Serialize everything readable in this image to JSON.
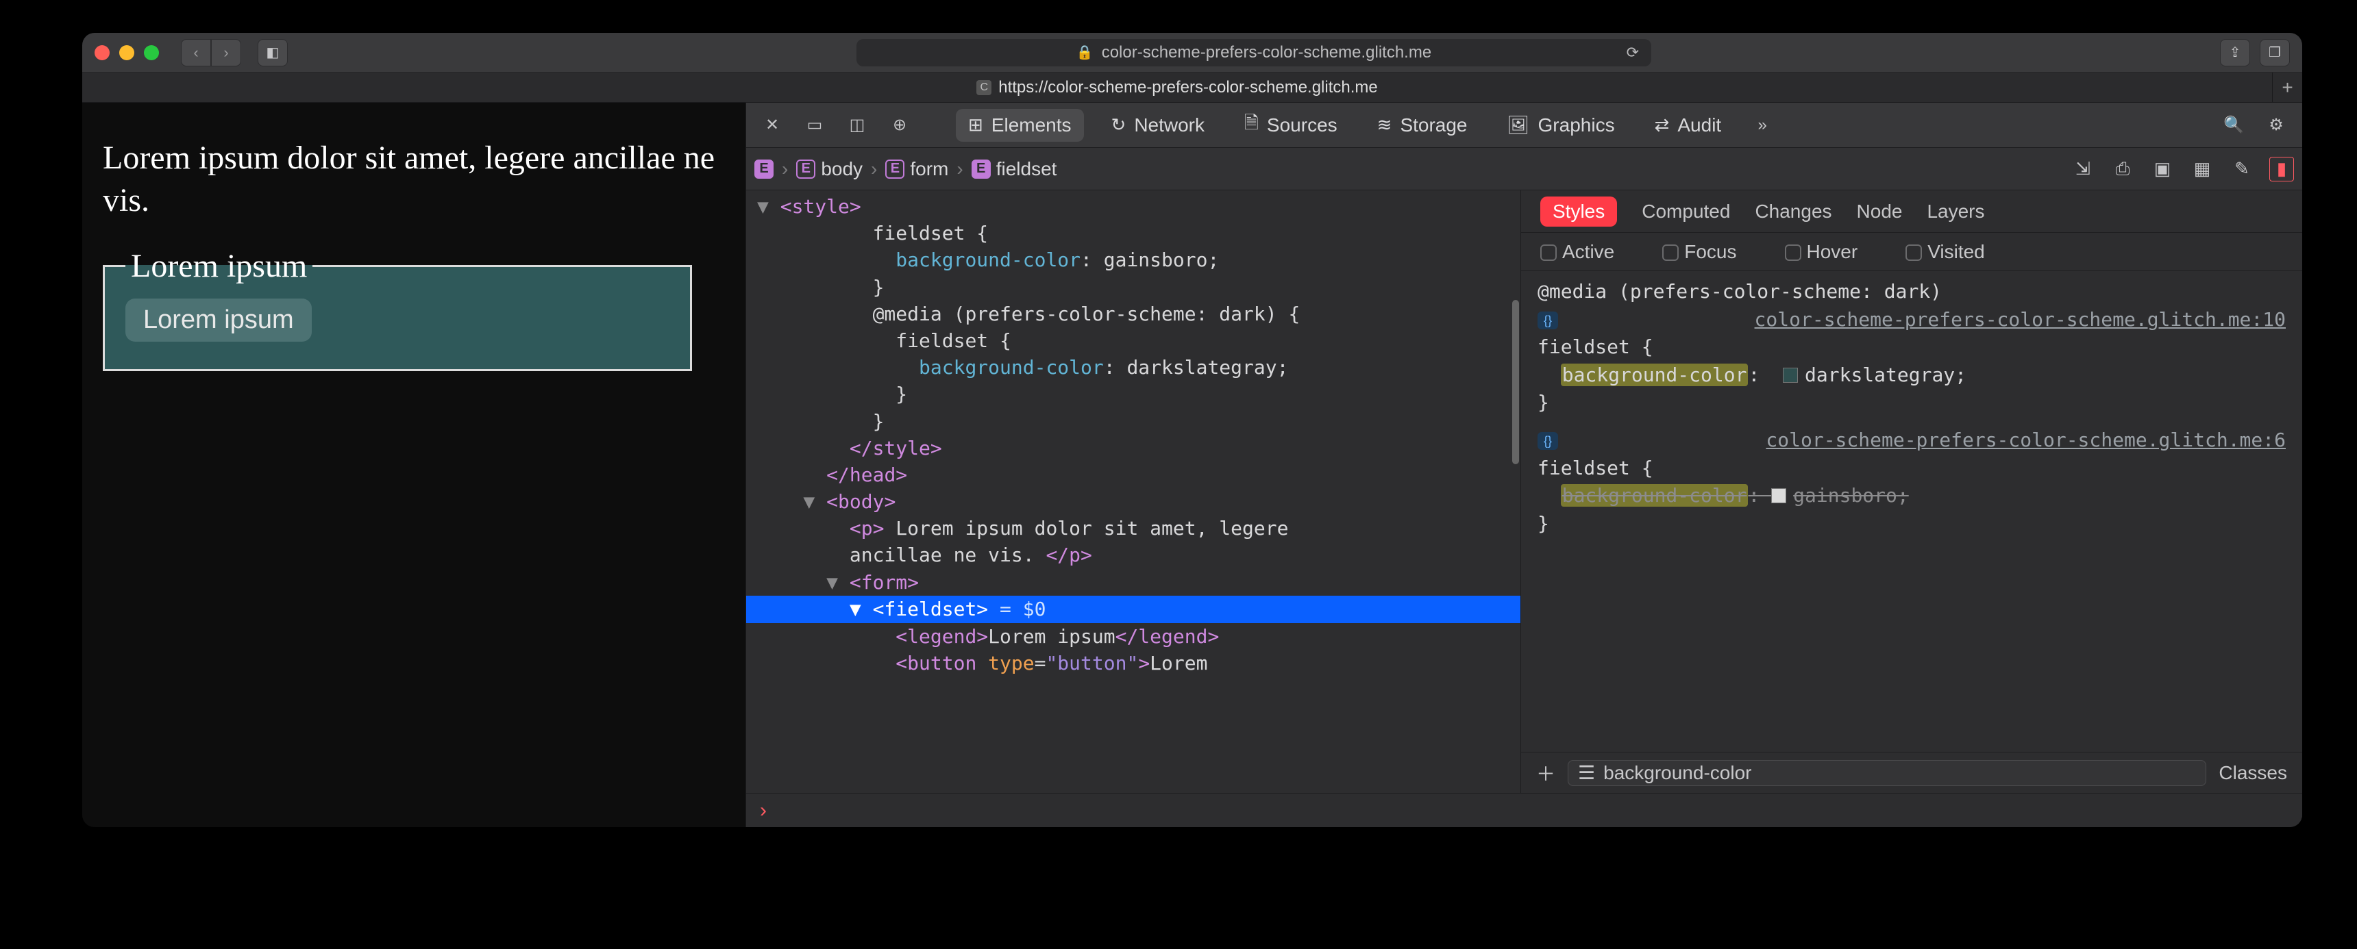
{
  "titlebar": {
    "url_display": "color-scheme-prefers-color-scheme.glitch.me"
  },
  "tab": {
    "favicon_letter": "C",
    "title": "https://color-scheme-prefers-color-scheme.glitch.me"
  },
  "page": {
    "paragraph": "Lorem ipsum dolor sit amet, legere ancillae ne vis.",
    "legend": "Lorem ipsum",
    "button": "Lorem ipsum"
  },
  "devtools": {
    "tabs": {
      "elements": "Elements",
      "network": "Network",
      "sources": "Sources",
      "storage": "Storage",
      "graphics": "Graphics",
      "audit": "Audit"
    },
    "breadcrumb": [
      "",
      "body",
      "form",
      "fieldset"
    ],
    "dom": {
      "l1": "      ▼ <style>",
      "l2": "          fieldset {",
      "l3": "            background-color: gainsboro;",
      "l4": "          }",
      "l5": "          @media (prefers-color-scheme: dark) {",
      "l6": "            fieldset {",
      "l7": "              background-color: darkslategray;",
      "l8": "            }",
      "l9": "          }",
      "l10": "        </style>",
      "l11": "      </head>",
      "l12": "    ▼ <body>",
      "l13a": "        <p> ",
      "l13b": "Lorem ipsum dolor sit amet, legere",
      "l14": "        ancillae ne vis. </p>",
      "l15": "      ▼ <form>",
      "sel": "        ▼ <fieldset>",
      "sel_suffix": " = $0",
      "l17": "            <legend>Lorem ipsum</legend>",
      "l18": "            <button type=\"button\">Lorem"
    },
    "styles": {
      "tabs": {
        "styles": "Styles",
        "computed": "Computed",
        "changes": "Changes",
        "node": "Node",
        "layers": "Layers"
      },
      "pseudo": {
        "active": "Active",
        "focus": "Focus",
        "hover": "Hover",
        "visited": "Visited"
      },
      "rule1": {
        "media": "@media (prefers-color-scheme: dark)",
        "source": "color-scheme-prefers-color-scheme.glitch.me:10",
        "selector": "fieldset",
        "prop": "background-color",
        "value": "darkslategray",
        "swatch": "#2f4f4f"
      },
      "rule2": {
        "source": "color-scheme-prefers-color-scheme.glitch.me:6",
        "selector": "fieldset",
        "prop": "background-color",
        "value": "gainsboro",
        "swatch": "#dcdcdc"
      },
      "filter_text": "background-color",
      "classes_label": "Classes"
    },
    "console_prompt": "›"
  }
}
